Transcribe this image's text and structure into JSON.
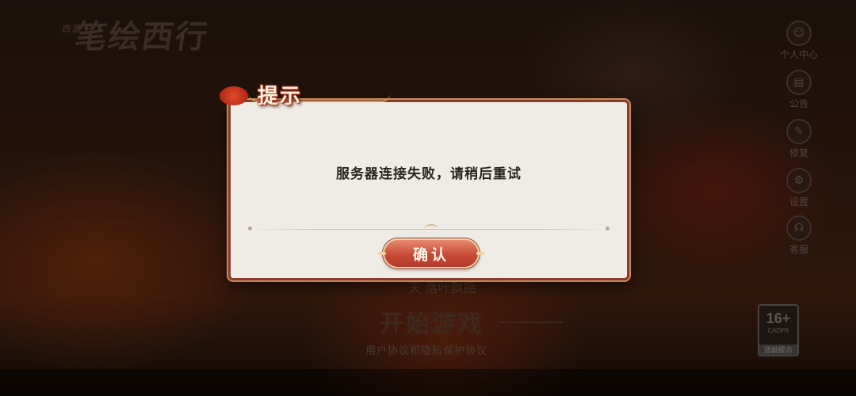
{
  "game": {
    "logo_small": "西游",
    "logo": "笔绘西行"
  },
  "side_menu": [
    {
      "label": "个人中心",
      "icon": "person-icon"
    },
    {
      "label": "公告",
      "icon": "notice-icon"
    },
    {
      "label": "修复",
      "icon": "wrench-icon"
    },
    {
      "label": "设置",
      "icon": "gear-icon"
    },
    {
      "label": "客服",
      "icon": "customer-service-icon"
    }
  ],
  "server": {
    "prefix": "天",
    "name": "落叶飘摇"
  },
  "start_button": "开始游戏",
  "agreement": "用户协议和隐私保护协议",
  "age_rating": {
    "age": "16+",
    "org": "CADPA",
    "tip": "适龄提示"
  },
  "dialog": {
    "title": "提示",
    "message": "服务器连接失败，请稍后重试",
    "confirm_label": "确认"
  },
  "colors": {
    "dialog_border": "#8a3a2a",
    "dialog_bg": "#efece6",
    "button_red": "#c94a36"
  }
}
